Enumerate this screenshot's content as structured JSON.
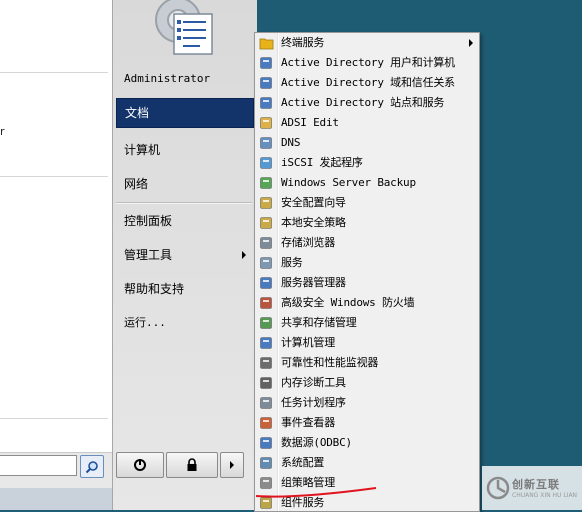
{
  "start_menu": {
    "places": {
      "user_name": "Administrator",
      "items": [
        {
          "label": "文档",
          "selected": true
        },
        {
          "label": "计算机"
        },
        {
          "label": "网络"
        },
        {
          "label": "控制面板"
        },
        {
          "label": "管理工具",
          "has_submenu": true
        },
        {
          "label": "帮助和支持"
        },
        {
          "label": "运行..."
        }
      ]
    },
    "programs": {
      "fragment_text": "r"
    },
    "search": {
      "value": ""
    },
    "power": {
      "shutdown_icon": "power-icon",
      "lock_icon": "lock-icon",
      "more_icon": "chevron-right-icon"
    }
  },
  "admin_tools_menu": {
    "items": [
      {
        "label": "终端服务",
        "icon": "folder-icon",
        "has_submenu": true
      },
      {
        "label": "Active Directory 用户和计算机",
        "icon": "ad-users-icon"
      },
      {
        "label": "Active Directory 域和信任关系",
        "icon": "ad-domains-icon"
      },
      {
        "label": "Active Directory 站点和服务",
        "icon": "ad-sites-icon"
      },
      {
        "label": "ADSI Edit",
        "icon": "adsi-edit-icon"
      },
      {
        "label": "DNS",
        "icon": "dns-icon"
      },
      {
        "label": "iSCSI 发起程序",
        "icon": "iscsi-icon"
      },
      {
        "label": "Windows Server Backup",
        "icon": "backup-icon"
      },
      {
        "label": "安全配置向导",
        "icon": "security-wizard-icon"
      },
      {
        "label": "本地安全策略",
        "icon": "local-policy-icon"
      },
      {
        "label": "存储浏览器",
        "icon": "storage-explorer-icon"
      },
      {
        "label": "服务",
        "icon": "services-icon"
      },
      {
        "label": "服务器管理器",
        "icon": "server-manager-icon"
      },
      {
        "label": "高级安全 Windows 防火墙",
        "icon": "firewall-icon"
      },
      {
        "label": "共享和存储管理",
        "icon": "share-storage-icon"
      },
      {
        "label": "计算机管理",
        "icon": "computer-management-icon"
      },
      {
        "label": "可靠性和性能监视器",
        "icon": "performance-monitor-icon"
      },
      {
        "label": "内存诊断工具",
        "icon": "memory-diagnostic-icon"
      },
      {
        "label": "任务计划程序",
        "icon": "task-scheduler-icon"
      },
      {
        "label": "事件查看器",
        "icon": "event-viewer-icon"
      },
      {
        "label": "数据源(ODBC)",
        "icon": "odbc-icon"
      },
      {
        "label": "系统配置",
        "icon": "system-config-icon"
      },
      {
        "label": "组策略管理",
        "icon": "group-policy-icon",
        "annotated": true
      },
      {
        "label": "组件服务",
        "icon": "component-services-icon"
      }
    ]
  },
  "watermark": {
    "text": "创新互联",
    "sub": "CHUANG XIN HU LIAN"
  },
  "colors": {
    "selected": "#12346b",
    "desktop": "#1e5c74",
    "annotation": "#e0141e"
  }
}
